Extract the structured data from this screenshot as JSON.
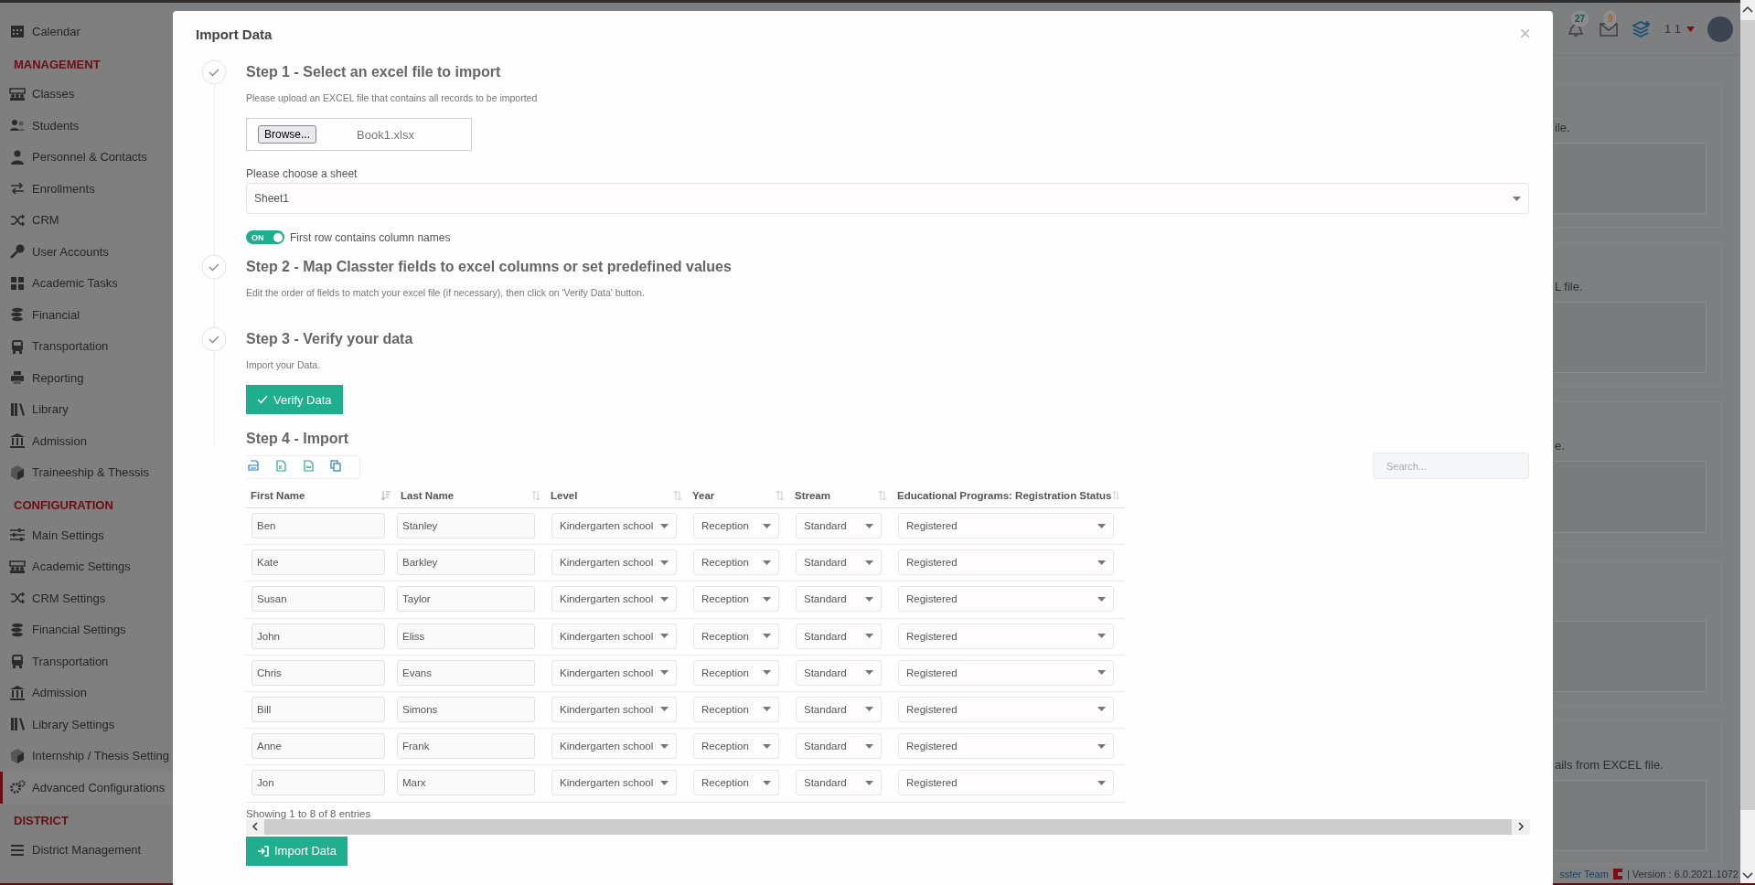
{
  "sidebar": {
    "items": [
      {
        "kind": "item",
        "label": "Calendar",
        "selected": false
      },
      {
        "kind": "heading",
        "label": "MANAGEMENT"
      },
      {
        "kind": "item",
        "label": "Classes",
        "selected": false
      },
      {
        "kind": "item",
        "label": "Students",
        "selected": false
      },
      {
        "kind": "item",
        "label": "Personnel & Contacts",
        "selected": false
      },
      {
        "kind": "item",
        "label": "Enrollments",
        "selected": false
      },
      {
        "kind": "item",
        "label": "CRM",
        "selected": false
      },
      {
        "kind": "item",
        "label": "User Accounts",
        "selected": false
      },
      {
        "kind": "item",
        "label": "Academic Tasks",
        "selected": false
      },
      {
        "kind": "item",
        "label": "Financial",
        "selected": false
      },
      {
        "kind": "item",
        "label": "Transportation",
        "selected": false
      },
      {
        "kind": "item",
        "label": "Reporting",
        "selected": false
      },
      {
        "kind": "item",
        "label": "Library",
        "selected": false
      },
      {
        "kind": "item",
        "label": "Admission",
        "selected": false
      },
      {
        "kind": "item",
        "label": "Traineeship & Thessis",
        "selected": false
      },
      {
        "kind": "heading",
        "label": "CONFIGURATION"
      },
      {
        "kind": "item",
        "label": "Main Settings",
        "selected": false
      },
      {
        "kind": "item",
        "label": "Academic Settings",
        "selected": false
      },
      {
        "kind": "item",
        "label": "CRM Settings",
        "selected": false
      },
      {
        "kind": "item",
        "label": "Financial Settings",
        "selected": false
      },
      {
        "kind": "item",
        "label": "Transportation",
        "selected": false
      },
      {
        "kind": "item",
        "label": "Admission",
        "selected": false
      },
      {
        "kind": "item",
        "label": "Library Settings",
        "selected": false
      },
      {
        "kind": "item",
        "label": "Internship / Thesis Setting",
        "selected": false
      },
      {
        "kind": "item",
        "label": "Advanced Configurations",
        "selected": true
      },
      {
        "kind": "heading",
        "label": "DISTRICT"
      },
      {
        "kind": "item",
        "label": "District Management",
        "selected": false
      }
    ]
  },
  "top_bar": {
    "notifications": "27",
    "messages": "9",
    "user": "1 1"
  },
  "background_cards": [
    {
      "kind": "text",
      "text": "ile."
    },
    {
      "kind": "text",
      "text": "L file."
    },
    {
      "kind": "text",
      "text": "e."
    },
    {
      "kind": "box"
    },
    {
      "kind": "text",
      "text": "ails from EXCEL file."
    }
  ],
  "footer": {
    "team": "sster Team",
    "version": "| Version : 6.0.2021.1072"
  },
  "modal": {
    "title": "Import Data",
    "close": "×",
    "steps": [
      {
        "kind": "file",
        "completed": true,
        "title": "Step 1 - Select an excel file to import",
        "description": "Please upload an EXCEL file that contains all records to be imported",
        "browse": "Browse...",
        "file_name": "Book1.xlsx",
        "sheet_label": "Please choose a sheet",
        "sheet": "Sheet1",
        "toggle": {
          "on": true,
          "label": "ON",
          "text": "First row contains column names"
        }
      },
      {
        "kind": "text",
        "completed": true,
        "title": "Step 2 - Map Classter fields to excel columns or set predefined values",
        "description": "Edit the order of fields to match your excel file (if necessary), then click on 'Verify Data' button."
      },
      {
        "kind": "verify",
        "completed": true,
        "title": "Step 3 - Verify your data",
        "description": "Import your Data.",
        "button": "Verify Data"
      },
      {
        "kind": "import",
        "completed": false,
        "title": "Step 4 - Import",
        "search": {
          "placeholder": "Search..."
        },
        "table": {
          "columns": [
            {
              "label": "First Name",
              "sorted": true
            },
            {
              "label": "Last Name",
              "sorted": false
            },
            {
              "label": "Level",
              "sorted": false
            },
            {
              "label": "Year",
              "sorted": false
            },
            {
              "label": "Stream",
              "sorted": false
            },
            {
              "label": "Educational Programs: Registration Status",
              "sorted": false
            }
          ],
          "rows": [
            [
              "Ben",
              "Stanley",
              "Kindergarten school",
              "Reception",
              "Standard",
              "Registered"
            ],
            [
              "Kate",
              "Barkley",
              "Kindergarten school",
              "Reception",
              "Standard",
              "Registered"
            ],
            [
              "Susan",
              "Taylor",
              "Kindergarten school",
              "Reception",
              "Standard",
              "Registered"
            ],
            [
              "John",
              "Eliss",
              "Kindergarten school",
              "Reception",
              "Standard",
              "Registered"
            ],
            [
              "Chris",
              "Evans",
              "Kindergarten school",
              "Reception",
              "Standard",
              "Registered"
            ],
            [
              "Bill",
              "Simons",
              "Kindergarten school",
              "Reception",
              "Standard",
              "Registered"
            ],
            [
              "Anne",
              "Frank",
              "Kindergarten school",
              "Reception",
              "Standard",
              "Registered"
            ],
            [
              "Jon",
              "Marx",
              "Kindergarten school",
              "Reception",
              "Standard",
              "Registered"
            ]
          ]
        },
        "info": "Showing 1 to 8 of 8 entries",
        "button": "Import Data"
      }
    ]
  }
}
